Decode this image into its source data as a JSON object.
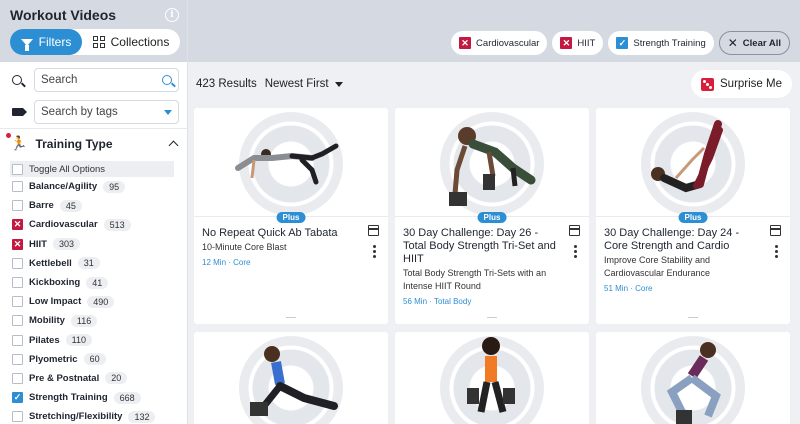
{
  "sidebar": {
    "title": "Workout Videos",
    "view_toggle": {
      "filters_label": "Filters",
      "collections_label": "Collections",
      "active": "Filters"
    },
    "search": {
      "placeholder": "Search"
    },
    "tag_search": {
      "placeholder": "Search by tags"
    },
    "section": {
      "title": "Training Type",
      "expanded": true
    },
    "toggle_all_label": "Toggle All Options",
    "options": [
      {
        "label": "Balance/Agility",
        "count": "95",
        "state": "unchecked"
      },
      {
        "label": "Barre",
        "count": "45",
        "state": "unchecked"
      },
      {
        "label": "Cardiovascular",
        "count": "513",
        "state": "excluded"
      },
      {
        "label": "HIIT",
        "count": "303",
        "state": "excluded"
      },
      {
        "label": "Kettlebell",
        "count": "31",
        "state": "unchecked"
      },
      {
        "label": "Kickboxing",
        "count": "41",
        "state": "unchecked"
      },
      {
        "label": "Low Impact",
        "count": "490",
        "state": "unchecked"
      },
      {
        "label": "Mobility",
        "count": "116",
        "state": "unchecked"
      },
      {
        "label": "Pilates",
        "count": "110",
        "state": "unchecked"
      },
      {
        "label": "Plyometric",
        "count": "60",
        "state": "unchecked"
      },
      {
        "label": "Pre & Postnatal",
        "count": "20",
        "state": "unchecked"
      },
      {
        "label": "Strength Training",
        "count": "668",
        "state": "checked"
      },
      {
        "label": "Stretching/Flexibility",
        "count": "132",
        "state": "unchecked"
      }
    ]
  },
  "active_filters": [
    {
      "label": "Cardiovascular",
      "state": "excluded"
    },
    {
      "label": "HIIT",
      "state": "excluded"
    },
    {
      "label": "Strength Training",
      "state": "checked"
    }
  ],
  "clear_all_label": "Clear All",
  "results": {
    "count_text": "423 Results",
    "sort_label": "Newest First",
    "surprise_label": "Surprise Me"
  },
  "badge_label": "Plus",
  "cards": [
    {
      "title": "No Repeat Quick Ab Tabata",
      "subtitle": "10-Minute Core Blast",
      "meta": "12 Min · Core"
    },
    {
      "title": "30 Day Challenge: Day 26 - Total Body Strength Tri-Set and HIIT",
      "subtitle": "Total Body Strength Tri-Sets with an Intense HIIT Round",
      "meta": "56 Min · Total Body"
    },
    {
      "title": "30 Day Challenge: Day 24 - Core Strength and Cardio",
      "subtitle": "Improve Core Stability and Cardiovascular Endurance",
      "meta": "51 Min · Core"
    }
  ],
  "colors": {
    "accent": "#2d8fd3",
    "exclude": "#c3183f",
    "header_bg": "#d5d9e2",
    "page_bg": "#eef0f4"
  }
}
